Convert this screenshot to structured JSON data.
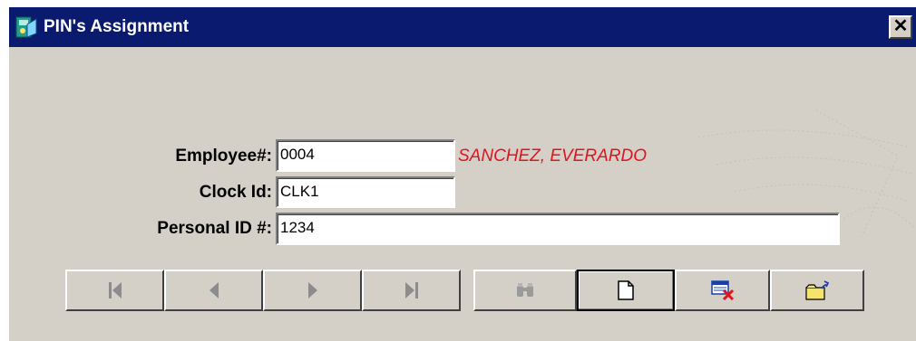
{
  "window": {
    "title": "PIN's Assignment",
    "close_label": "✕"
  },
  "form": {
    "employee_label": "Employee#:",
    "employee_value": "0004",
    "employee_name": "SANCHEZ, EVERARDO",
    "clock_label": "Clock Id:",
    "clock_value": "CLK1",
    "pin_label": "Personal ID #:",
    "pin_value": "1234"
  },
  "toolbar": {
    "nav_buttons": [
      {
        "icon": "first-record-icon",
        "enabled": false
      },
      {
        "icon": "previous-record-icon",
        "enabled": false
      },
      {
        "icon": "next-record-icon",
        "enabled": false
      },
      {
        "icon": "last-record-icon",
        "enabled": false
      }
    ],
    "action_buttons": [
      {
        "icon": "binoculars-find-icon",
        "enabled": false
      },
      {
        "icon": "new-document-icon",
        "enabled": true
      },
      {
        "icon": "delete-record-icon",
        "enabled": true
      },
      {
        "icon": "open-folder-icon",
        "enabled": true
      }
    ]
  },
  "colors": {
    "titlebar": "#0a1a6e",
    "name_text": "#e0141e",
    "window_bg": "#d4d0c8"
  }
}
